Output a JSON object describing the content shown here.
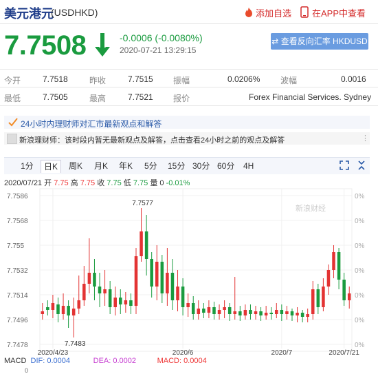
{
  "header": {
    "title": "美元港元",
    "code": "(USDHKD)",
    "fav_label": "添加自选",
    "app_label": "在APP中查看"
  },
  "quote": {
    "price": "7.7508",
    "change": "-0.0006 (-0.0080%)",
    "time": "2020-07-21 13:29:15",
    "reverse_label": "查看反向汇率 HKDUSD"
  },
  "stats": {
    "row1": [
      {
        "label": "今开",
        "value": "7.7518"
      },
      {
        "label": "昨收",
        "value": "7.7515"
      },
      {
        "label": "振幅",
        "value": "0.0206%"
      },
      {
        "label": "波幅",
        "value": "0.0016"
      }
    ],
    "row2": [
      {
        "label": "最低",
        "value": "7.7505"
      },
      {
        "label": "最高",
        "value": "7.7521"
      },
      {
        "label": "报价",
        "value": "Forex Financial Services. Sydney"
      }
    ]
  },
  "notice": {
    "title": "24小时内理财师对汇市最新观点和解答",
    "feed_text": "新浪理财师：该时段内暂无最新观点及解答，点击查看24小时之前的观点及解答"
  },
  "tabs": [
    "1分",
    "日K",
    "周K",
    "月K",
    "年K",
    "5分",
    "15分",
    "30分",
    "60分",
    "4H"
  ],
  "active_tab": "日K",
  "ohlc": {
    "date": "2020/07/21",
    "open_label": "开",
    "open": "7.75",
    "high_label": "高",
    "high": "7.75",
    "close_label": "收",
    "close": "7.75",
    "low_label": "低",
    "low": "7.75",
    "vol_label": "量",
    "vol": "0",
    "pct": "-0.01%"
  },
  "macd": {
    "label": "MACD",
    "dif": "DIF: 0.0004",
    "dea": "DEA: 0.0002",
    "macd": "MACD: 0.0004"
  },
  "colors": {
    "up": "#e33333",
    "down": "#1a9b3f",
    "accent": "#6a9ce0",
    "title": "#1f3d8a"
  },
  "chart_data": {
    "type": "candlestick",
    "watermark": "新浪财经",
    "y_ticks": [
      "7.7586",
      "7.7568",
      "7.755",
      "7.7532",
      "7.7514",
      "7.7496",
      "7.7478"
    ],
    "y_ticks_right": [
      "0%",
      "0%",
      "0%",
      "0%",
      "0%",
      "0%",
      "0%"
    ],
    "ylim": [
      7.7478,
      7.7586
    ],
    "x_labels": [
      {
        "label": "2020/4/23",
        "index": 2
      },
      {
        "label": "2020/6",
        "index": 27
      },
      {
        "label": "2020/7",
        "index": 46
      },
      {
        "label": "2020/7/21",
        "index": 58
      }
    ],
    "annotations": [
      {
        "label": "7.7577",
        "index": 19,
        "value": 7.7577
      },
      {
        "label": "7.7483",
        "index": 6,
        "value": 7.7483
      }
    ],
    "candles": [
      [
        7.75,
        7.7502,
        7.7508,
        7.7496
      ],
      [
        7.7505,
        7.7503,
        7.751,
        7.7499
      ],
      [
        7.7503,
        7.7508,
        7.7514,
        7.7497
      ],
      [
        7.7507,
        7.75,
        7.7512,
        7.7494
      ],
      [
        7.75,
        7.7506,
        7.7515,
        7.7496
      ],
      [
        7.7506,
        7.7499,
        7.751,
        7.749
      ],
      [
        7.7499,
        7.7504,
        7.7512,
        7.7483
      ],
      [
        7.7504,
        7.751,
        7.7528,
        7.75
      ],
      [
        7.751,
        7.7522,
        7.7535,
        7.7506
      ],
      [
        7.7522,
        7.753,
        7.7555,
        7.7515
      ],
      [
        7.753,
        7.752,
        7.754,
        7.751
      ],
      [
        7.752,
        7.7515,
        7.753,
        7.7505
      ],
      [
        7.7515,
        7.7518,
        7.7532,
        7.7506
      ],
      [
        7.7518,
        7.7505,
        7.7524,
        7.75
      ],
      [
        7.7505,
        7.7512,
        7.752,
        7.7499
      ],
      [
        7.7512,
        7.7507,
        7.7518,
        7.75
      ],
      [
        7.7507,
        7.751,
        7.7516,
        7.7501
      ],
      [
        7.751,
        7.7506,
        7.7515,
        7.75
      ],
      [
        7.7506,
        7.7542,
        7.7548,
        7.75
      ],
      [
        7.7542,
        7.756,
        7.7577,
        7.7538
      ],
      [
        7.756,
        7.754,
        7.7572,
        7.7528
      ],
      [
        7.754,
        7.752,
        7.7545,
        7.7512
      ],
      [
        7.752,
        7.7538,
        7.755,
        7.751
      ],
      [
        7.7538,
        7.7515,
        7.7543,
        7.7508
      ],
      [
        7.7515,
        7.753,
        7.7548,
        7.7506
      ],
      [
        7.753,
        7.751,
        7.754,
        7.7503
      ],
      [
        7.751,
        7.752,
        7.7532,
        7.7502
      ],
      [
        7.752,
        7.7505,
        7.7526,
        7.7499
      ],
      [
        7.7505,
        7.7508,
        7.7515,
        7.7498
      ],
      [
        7.7508,
        7.75,
        7.7513,
        7.7496
      ],
      [
        7.75,
        7.7504,
        7.751,
        7.7496
      ],
      [
        7.7504,
        7.7501,
        7.7508,
        7.7497
      ],
      [
        7.7501,
        7.7505,
        7.751,
        7.7497
      ],
      [
        7.7505,
        7.75,
        7.7509,
        7.7496
      ],
      [
        7.75,
        7.7503,
        7.7507,
        7.7496
      ],
      [
        7.7503,
        7.7505,
        7.751,
        7.7497
      ],
      [
        7.7505,
        7.75,
        7.7508,
        7.7495
      ],
      [
        7.75,
        7.7502,
        7.7527,
        7.7496
      ],
      [
        7.7502,
        7.7499,
        7.7506,
        7.7495
      ],
      [
        7.7499,
        7.7503,
        7.7507,
        7.7496
      ],
      [
        7.7503,
        7.75,
        7.7507,
        7.7496
      ],
      [
        7.75,
        7.7502,
        7.7506,
        7.7496
      ],
      [
        7.7502,
        7.7499,
        7.7505,
        7.7495
      ],
      [
        7.7499,
        7.7501,
        7.7506,
        7.7496
      ],
      [
        7.7501,
        7.75,
        7.7505,
        7.7496
      ],
      [
        7.75,
        7.7503,
        7.7508,
        7.7497
      ],
      [
        7.7503,
        7.75,
        7.7507,
        7.7495
      ],
      [
        7.75,
        7.7502,
        7.7506,
        7.7496
      ],
      [
        7.7502,
        7.7499,
        7.7504,
        7.7495
      ],
      [
        7.7499,
        7.7501,
        7.7505,
        7.7494
      ],
      [
        7.7501,
        7.7498,
        7.7503,
        7.7494
      ],
      [
        7.7498,
        7.75,
        7.7504,
        7.7494
      ],
      [
        7.75,
        7.7518,
        7.7524,
        7.7496
      ],
      [
        7.7518,
        7.7505,
        7.7522,
        7.75
      ],
      [
        7.7505,
        7.752,
        7.7526,
        7.7502
      ],
      [
        7.752,
        7.7532,
        7.7536,
        7.7514
      ],
      [
        7.7532,
        7.7545,
        7.755,
        7.7526
      ],
      [
        7.7545,
        7.7525,
        7.7548,
        7.7518
      ],
      [
        7.7525,
        7.751,
        7.753,
        7.7506
      ],
      [
        7.751,
        7.7515,
        7.752,
        7.7504
      ]
    ]
  }
}
